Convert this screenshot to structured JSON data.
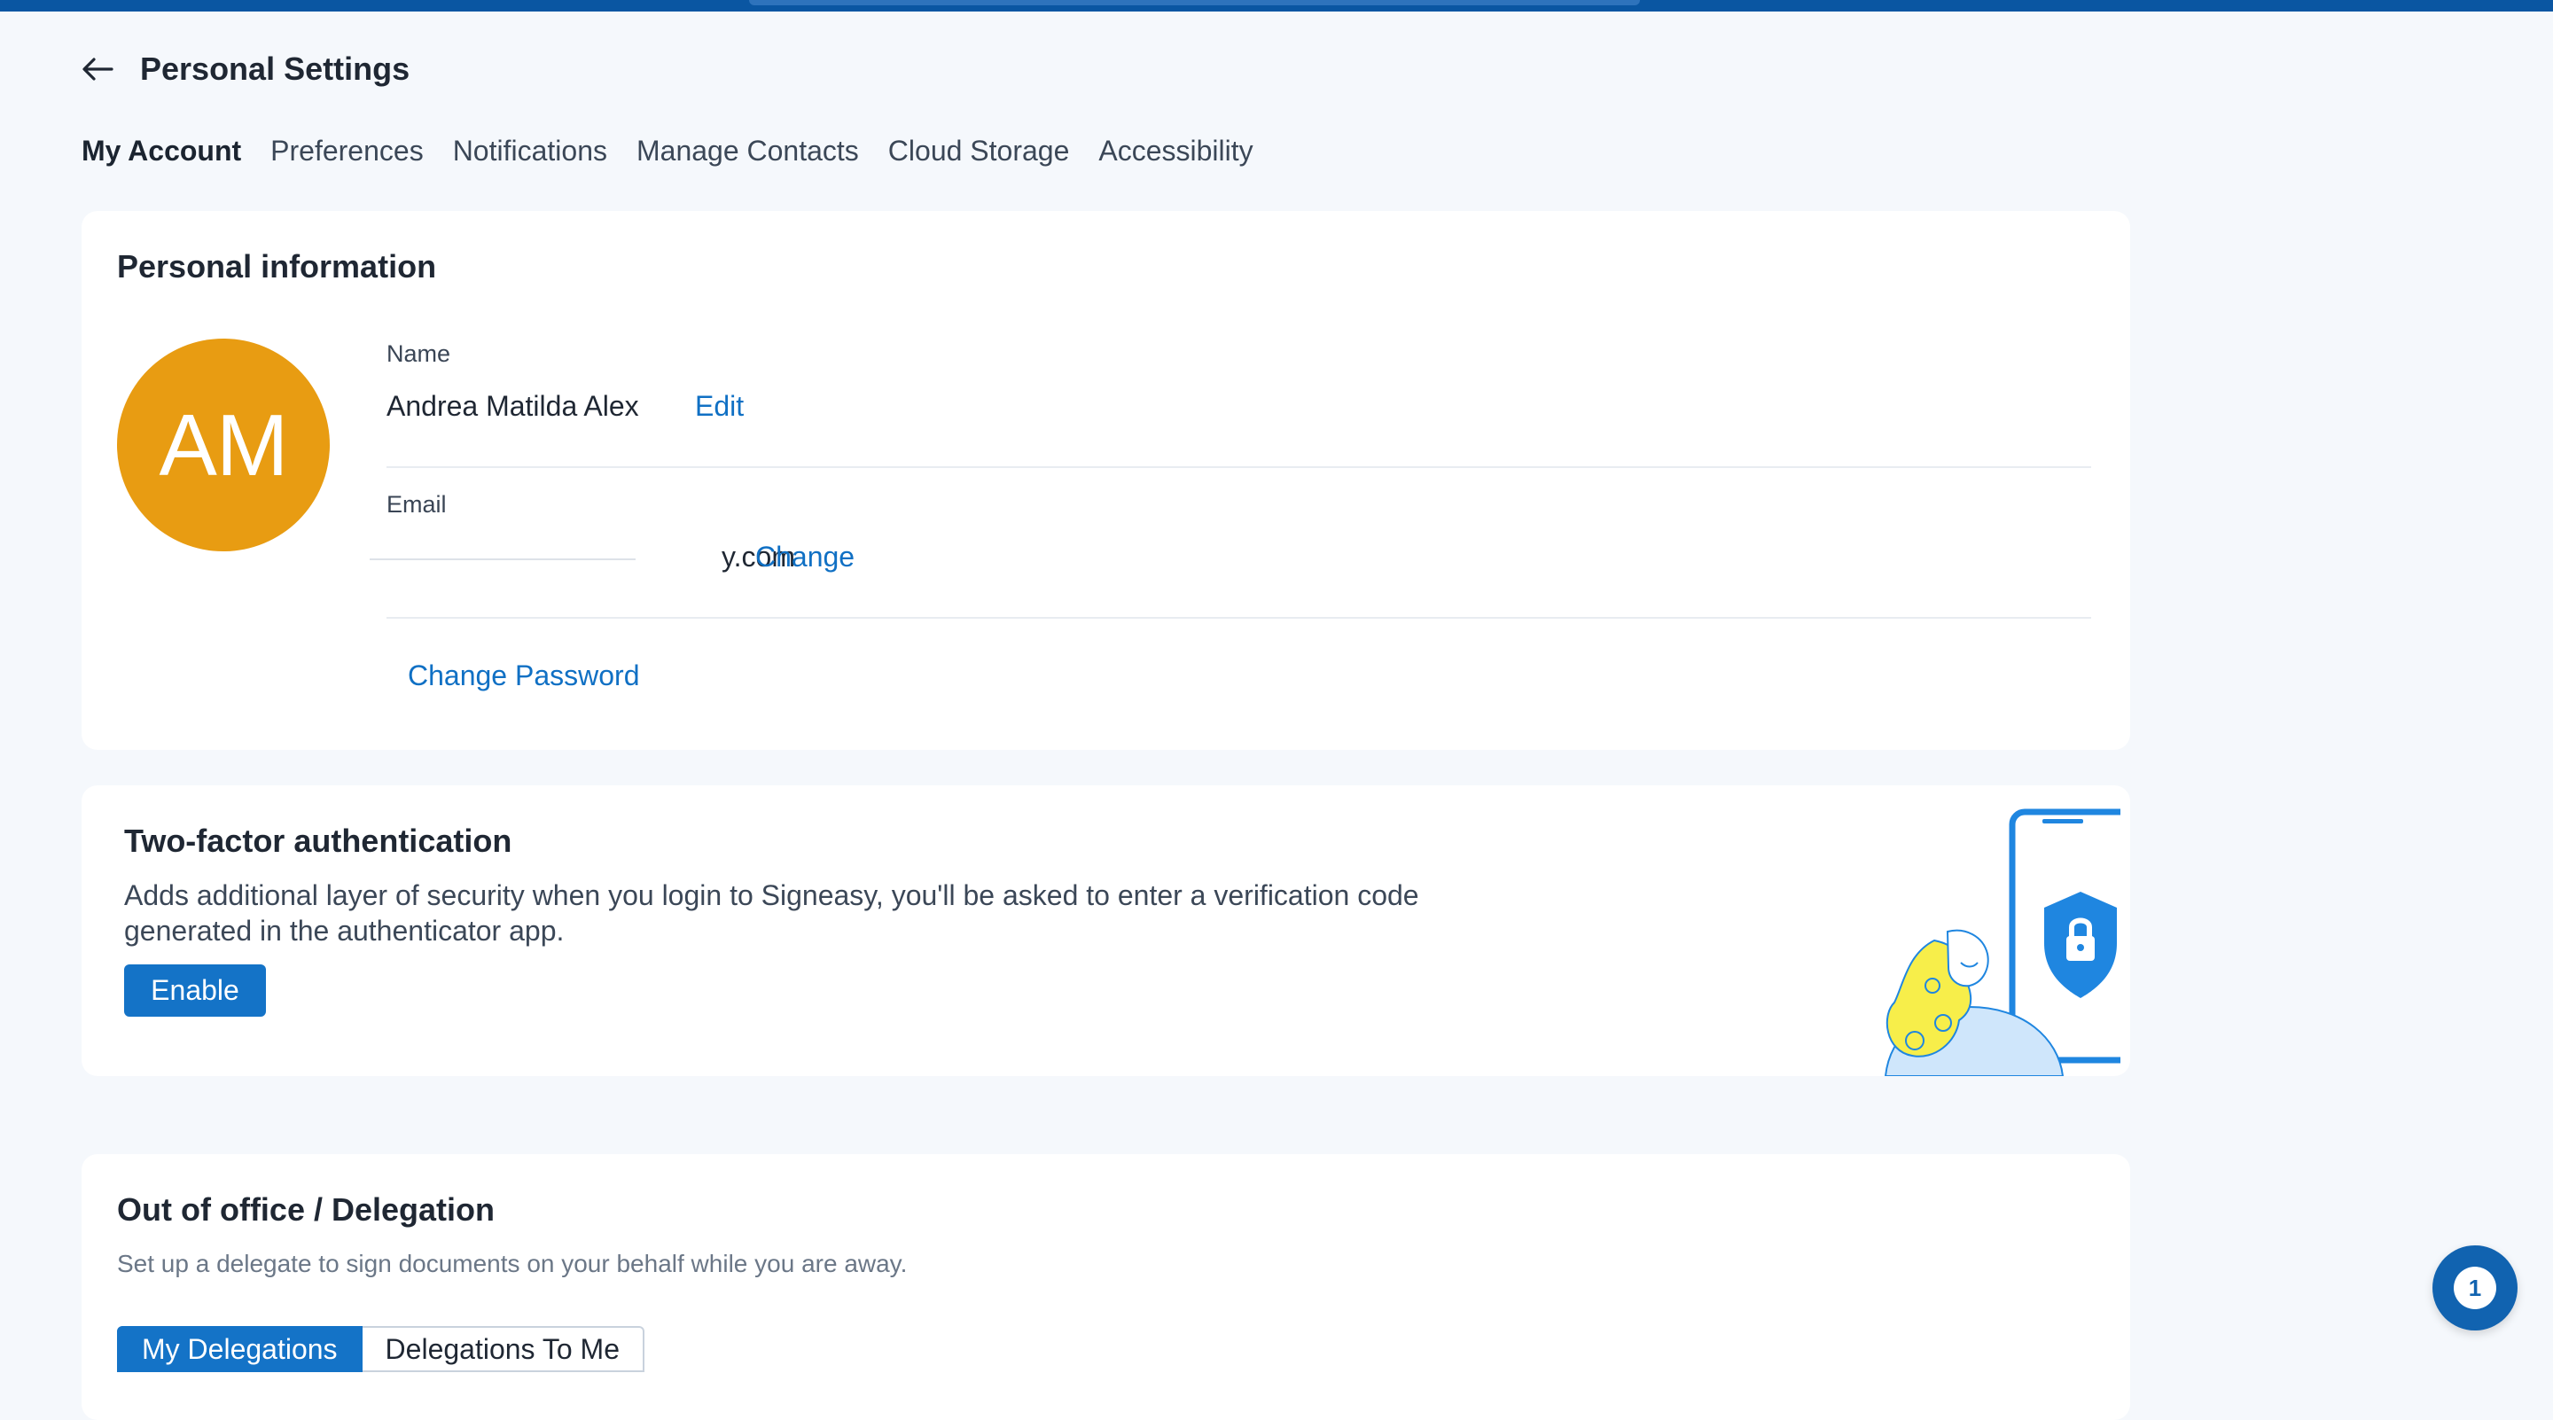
{
  "header": {
    "title": "Personal Settings"
  },
  "tabs": [
    {
      "label": "My Account",
      "active": true
    },
    {
      "label": "Preferences"
    },
    {
      "label": "Notifications"
    },
    {
      "label": "Manage Contacts"
    },
    {
      "label": "Cloud Storage"
    },
    {
      "label": "Accessibility"
    }
  ],
  "personal": {
    "title": "Personal information",
    "avatar_initials": "AM",
    "avatar_color": "#e89c12",
    "name_label": "Name",
    "name_value": "Andrea Matilda Alex",
    "name_edit": "Edit",
    "email_label": "Email",
    "email_value": "y.com",
    "email_change": "Change",
    "change_password": "Change Password"
  },
  "two_factor": {
    "title": "Two-factor authentication",
    "description_line1": "Adds additional layer of security when you login to Signeasy, you'll be asked to enter a verification code",
    "description_line2": "generated in the authenticator app.",
    "enable_button": "Enable"
  },
  "out_of_office": {
    "title": "Out of office / Delegation",
    "subtitle": "Set up a delegate to sign documents on your behalf while you are away.",
    "tabs": [
      {
        "label": "My Delegations",
        "active": true
      },
      {
        "label": "Delegations To Me"
      }
    ]
  },
  "notification_badge": {
    "count": "1"
  },
  "colors": {
    "accent": "#1473c7",
    "top_bar": "#0a56a2"
  }
}
